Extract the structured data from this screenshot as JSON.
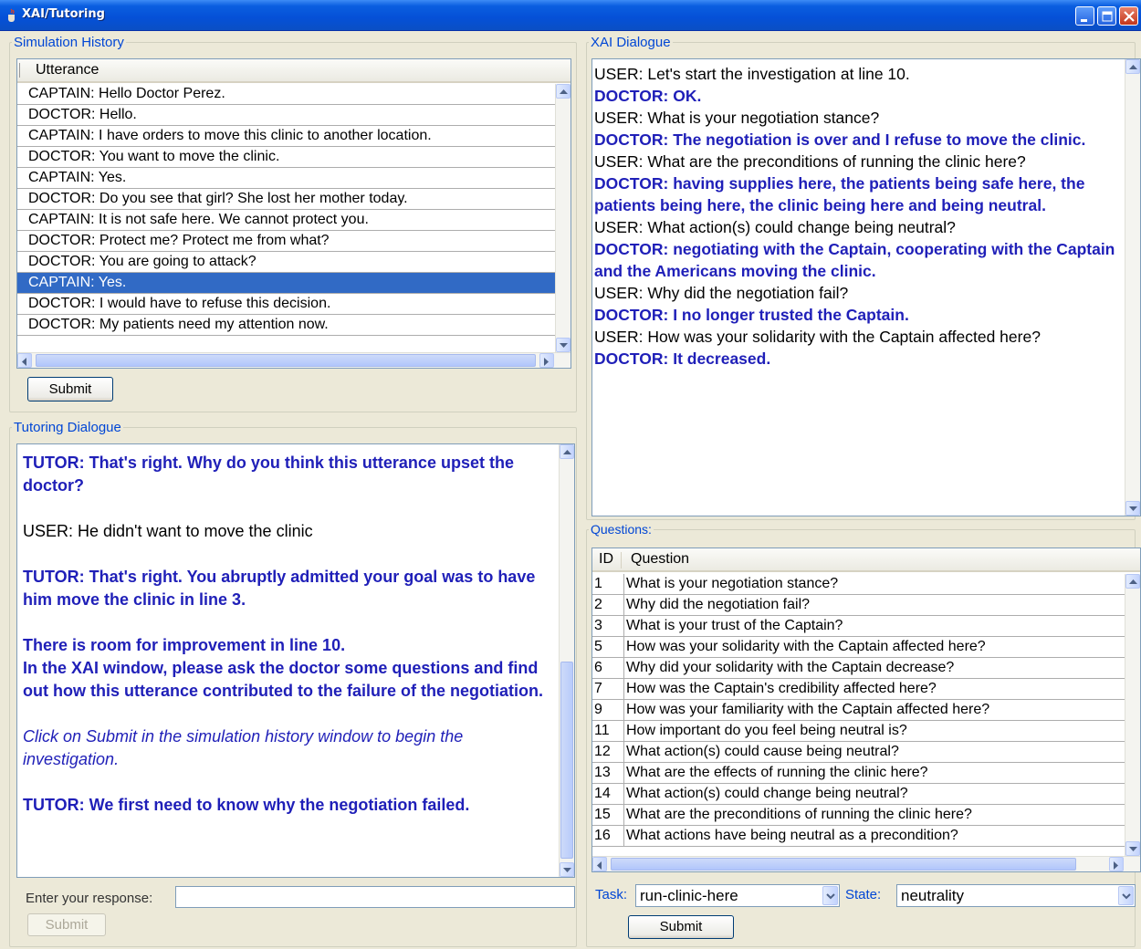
{
  "window": {
    "title": "XAI/Tutoring"
  },
  "simulation_history": {
    "legend": "Simulation History",
    "column_header": "Utterance",
    "rows": [
      "CAPTAIN: Hello Doctor Perez.",
      "DOCTOR: Hello.",
      "CAPTAIN: I have orders to move this clinic to another location.",
      "DOCTOR: You want to move the clinic.",
      "CAPTAIN: Yes.",
      "DOCTOR: Do you see that girl? She lost her mother today.",
      "CAPTAIN: It is not safe here. We cannot protect you.",
      "DOCTOR: Protect me? Protect me from what?",
      "DOCTOR: You are going to attack?",
      "CAPTAIN: Yes.",
      "DOCTOR: I would have to refuse this decision.",
      "DOCTOR: My patients need my attention now."
    ],
    "selected_index": 9,
    "submit_label": "Submit"
  },
  "tutoring_dialogue": {
    "legend": "Tutoring Dialogue",
    "lines": [
      "TUTOR: That's right. Why do you think this utterance upset the doctor?",
      "USER: He didn't want to move the clinic",
      "TUTOR: That's right. You abruptly admitted your goal was to have him move the clinic in line 3.",
      "There is room for improvement in line 10.",
      "In the XAI window, please ask the doctor some questions and find out how this utterance contributed to the failure of the negotiation.",
      "Click on Submit in the simulation history window to begin the investigation.",
      "TUTOR: We first need to know why the negotiation failed."
    ],
    "response_label": "Enter your response:",
    "response_value": "",
    "submit_label": "Submit"
  },
  "xai_dialogue": {
    "legend": "XAI Dialogue",
    "lines": [
      "USER: Let's start the investigation at line 10.",
      "DOCTOR: OK.",
      "USER: What is your negotiation stance?",
      "DOCTOR: The negotiation is over and I refuse to move the clinic.",
      "USER: What are the preconditions of running the clinic here?",
      "DOCTOR: having supplies here, the patients being safe here, the patients being here, the clinic being here and being neutral.",
      "USER: What action(s) could change being neutral?",
      "DOCTOR: negotiating with the Captain, cooperating with the Captain and the Americans moving the clinic.",
      "USER: Why did the negotiation fail?",
      "DOCTOR: I no longer trusted the Captain.",
      "USER: How was your solidarity with the Captain affected here?",
      "DOCTOR: It decreased."
    ]
  },
  "questions": {
    "legend": "Questions:",
    "col_id": "ID",
    "col_question": "Question",
    "rows": [
      {
        "id": "1",
        "q": "What is your negotiation stance?"
      },
      {
        "id": "2",
        "q": "Why did the negotiation fail?"
      },
      {
        "id": "3",
        "q": "What is your trust of the Captain?"
      },
      {
        "id": "5",
        "q": "How was your solidarity with the Captain affected here?"
      },
      {
        "id": "6",
        "q": "Why did your solidarity with the Captain decrease?"
      },
      {
        "id": "7",
        "q": "How was the Captain's credibility affected here?"
      },
      {
        "id": "9",
        "q": "How was your familiarity with the Captain affected here?"
      },
      {
        "id": "11",
        "q": "How important do you feel being neutral is?"
      },
      {
        "id": "12",
        "q": "What action(s) could cause being neutral?"
      },
      {
        "id": "13",
        "q": "What are the effects of running the clinic here?"
      },
      {
        "id": "14",
        "q": "What action(s) could change being neutral?"
      },
      {
        "id": "15",
        "q": "What are the preconditions of running the clinic here?"
      },
      {
        "id": "16",
        "q": "What actions have being neutral as a precondition?"
      }
    ],
    "task_label": "Task:",
    "task_value": "run-clinic-here",
    "state_label": "State:",
    "state_value": "neutrality",
    "submit_label": "Submit"
  },
  "colors": {
    "accent_blue": "#1f1fb8",
    "legend_blue": "#0046d5",
    "selection": "#316ac5"
  },
  "icons": [
    "java-cup-icon",
    "minimize-icon",
    "maximize-icon",
    "close-icon",
    "scroll-up-icon",
    "scroll-down-icon",
    "scroll-left-icon",
    "scroll-right-icon",
    "dropdown-arrow-icon"
  ]
}
